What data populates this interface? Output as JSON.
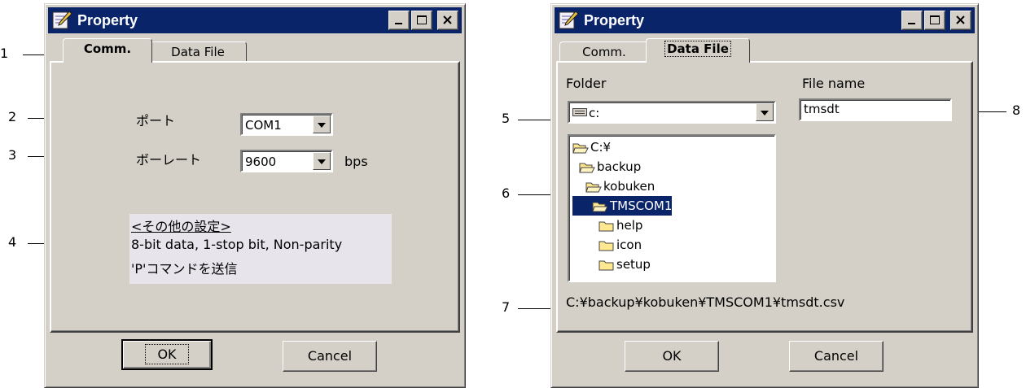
{
  "colors": {
    "face": "#d4d0c8",
    "titlebar": "#0a246a",
    "selection": "#0a246a",
    "folder": "#ffe890",
    "info_box": "#e8e4ec"
  },
  "callouts": {
    "c1": "1",
    "c2": "2",
    "c3": "3",
    "c4": "4",
    "c5": "5",
    "c6": "6",
    "c7": "7",
    "c8": "8"
  },
  "dialog_comm": {
    "title": "Property",
    "title_icon": "property-pen-icon",
    "tabs": [
      {
        "label": "Comm.",
        "active": true
      },
      {
        "label": "Data File",
        "active": false
      }
    ],
    "port_label": "ポート",
    "port_value": "COM1",
    "baud_label": "ボーレート",
    "baud_value": "9600",
    "baud_unit": "bps",
    "info_heading": "<その他の設定>",
    "info_line1": "8-bit data, 1-stop bit, Non-parity",
    "info_line2": "'P'コマンドを送信",
    "ok_label": "OK",
    "cancel_label": "Cancel"
  },
  "dialog_file": {
    "title": "Property",
    "title_icon": "property-pen-icon",
    "tabs": [
      {
        "label": "Comm.",
        "active": false
      },
      {
        "label": "Data File",
        "active": true
      }
    ],
    "folder_label": "Folder",
    "drive_value": "c:",
    "drive_icon": "drive-icon",
    "filename_label": "File name",
    "filename_value": "tmsdt",
    "tree": [
      {
        "label": "C:¥",
        "depth": 0,
        "open": true,
        "selected": false
      },
      {
        "label": "backup",
        "depth": 1,
        "open": true,
        "selected": false
      },
      {
        "label": "kobuken",
        "depth": 2,
        "open": true,
        "selected": false
      },
      {
        "label": "TMSCOM1",
        "depth": 3,
        "open": true,
        "selected": true
      },
      {
        "label": "help",
        "depth": 4,
        "open": false,
        "selected": false
      },
      {
        "label": "icon",
        "depth": 4,
        "open": false,
        "selected": false
      },
      {
        "label": "setup",
        "depth": 4,
        "open": false,
        "selected": false
      }
    ],
    "path_value": "C:¥backup¥kobuken¥TMSCOM1¥tmsdt.csv",
    "ok_label": "OK",
    "cancel_label": "Cancel"
  }
}
